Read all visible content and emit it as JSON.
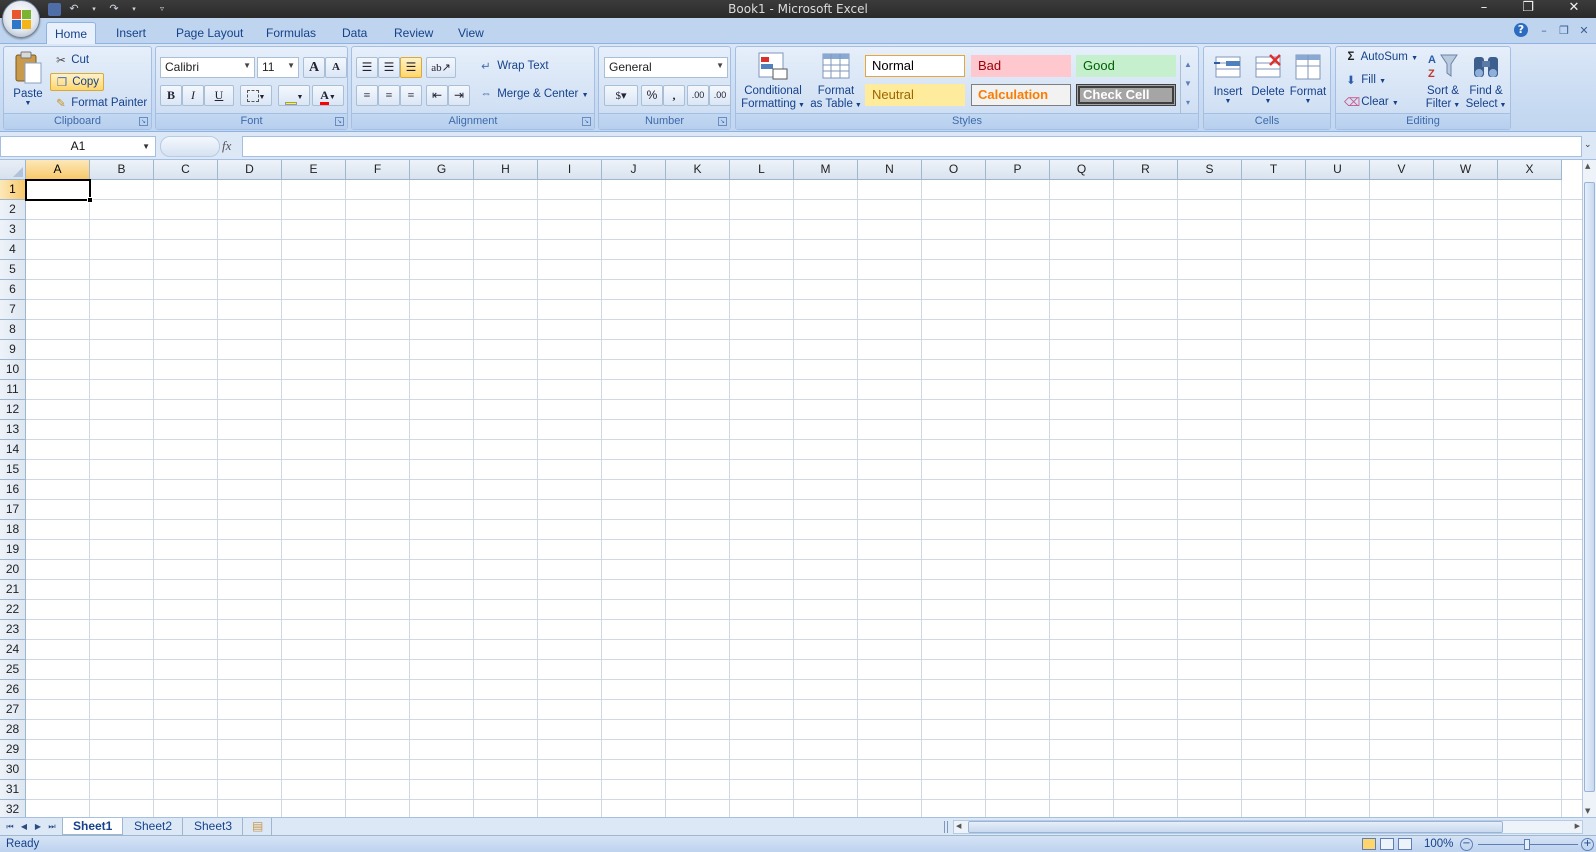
{
  "window": {
    "title": "Book1 - Microsoft Excel",
    "minimize": "–",
    "restore": "❐",
    "close": "✕"
  },
  "ribbon_tabs": [
    "Home",
    "Insert",
    "Page Layout",
    "Formulas",
    "Data",
    "Review",
    "View"
  ],
  "clipboard": {
    "label": "Clipboard",
    "paste": "Paste",
    "cut": "Cut",
    "copy": "Copy",
    "format_painter": "Format Painter"
  },
  "font": {
    "label": "Font",
    "name": "Calibri",
    "size": "11",
    "bold": "B",
    "italic": "I",
    "underline": "U",
    "grow": "A",
    "shrink": "A",
    "font_color_glyph": "A"
  },
  "alignment": {
    "label": "Alignment",
    "wrap_text": "Wrap Text",
    "merge_center": "Merge & Center"
  },
  "number": {
    "label": "Number",
    "format": "General",
    "percent": "%",
    "comma": ",",
    "inc_decimal": ".00",
    "dec_decimal": ".00"
  },
  "styles": {
    "label": "Styles",
    "conditional_formatting": [
      "Conditional",
      "Formatting"
    ],
    "format_as_table": [
      "Format",
      "as Table"
    ],
    "cells": [
      {
        "name": "Normal",
        "bg": "#ffffff",
        "fg": "#000000",
        "border": "#e8a53a"
      },
      {
        "name": "Bad",
        "bg": "#ffc7ce",
        "fg": "#9c0006",
        "border": "#ffc7ce"
      },
      {
        "name": "Good",
        "bg": "#c6efce",
        "fg": "#006100",
        "border": "#c6efce"
      },
      {
        "name": "Neutral",
        "bg": "#ffeb9c",
        "fg": "#9c6500",
        "border": "#ffeb9c"
      },
      {
        "name": "Calculation",
        "bg": "#f2f2f2",
        "fg": "#fa7d00",
        "border": "#7f7f7f"
      },
      {
        "name": "Check Cell",
        "bg": "#a5a5a5",
        "fg": "#ffffff",
        "border": "#3f3f3f"
      }
    ]
  },
  "cells_group": {
    "label": "Cells",
    "insert": "Insert",
    "delete": "Delete",
    "format": "Format"
  },
  "editing": {
    "label": "Editing",
    "autosum": "AutoSum",
    "fill": "Fill",
    "clear": "Clear",
    "sort_filter": [
      "Sort &",
      "Filter"
    ],
    "find_select": [
      "Find &",
      "Select"
    ]
  },
  "formula_bar": {
    "name_box": "A1",
    "fx": "fx",
    "value": ""
  },
  "columns": [
    "A",
    "B",
    "C",
    "D",
    "E",
    "F",
    "G",
    "H",
    "I",
    "J",
    "K",
    "L",
    "M",
    "N",
    "O",
    "P",
    "Q",
    "R",
    "S",
    "T",
    "U",
    "V",
    "W",
    "X"
  ],
  "rows": [
    "1",
    "2",
    "3",
    "4",
    "5",
    "6",
    "7",
    "8",
    "9",
    "10",
    "11",
    "12",
    "13",
    "14",
    "15",
    "16",
    "17",
    "18",
    "19",
    "20",
    "21",
    "22",
    "23",
    "24",
    "25",
    "26",
    "27",
    "28",
    "29",
    "30",
    "31",
    "32"
  ],
  "selected_cell": {
    "column": "A",
    "row": "1"
  },
  "sheets": [
    "Sheet1",
    "Sheet2",
    "Sheet3"
  ],
  "active_sheet": "Sheet1",
  "status": {
    "text": "Ready",
    "zoom": "100%"
  },
  "colors": {
    "accent": "#15428b",
    "ribbon": "#c7daf2",
    "selection": "#f7c86b"
  }
}
